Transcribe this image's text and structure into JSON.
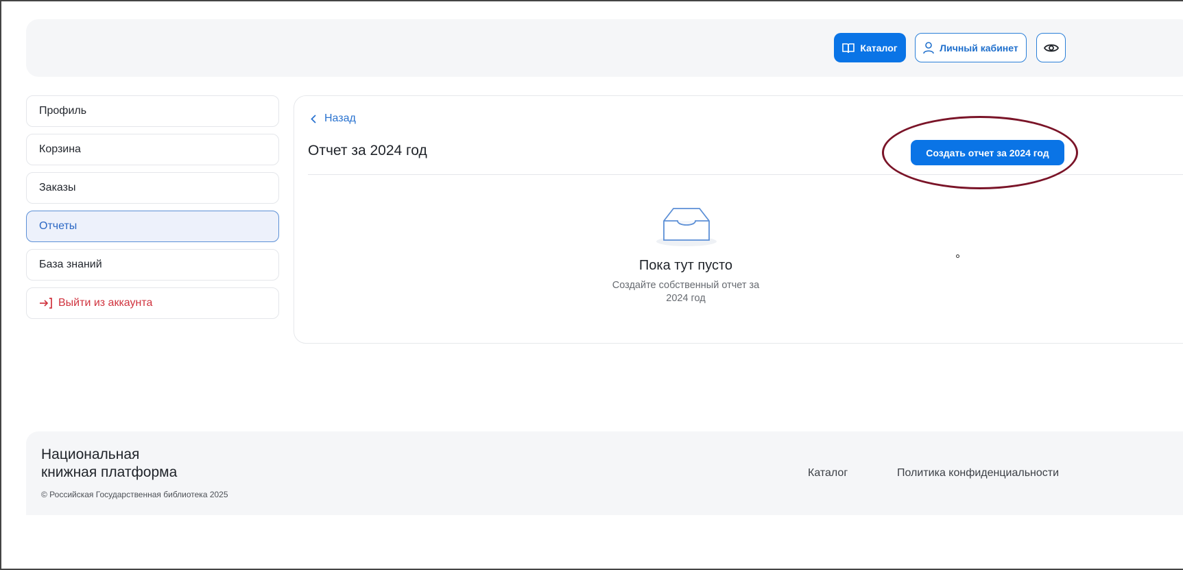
{
  "header": {
    "catalog_label": "Каталог",
    "cabinet_label": "Личный кабинет",
    "catalog_icon": "book-icon",
    "cabinet_icon": "user-icon",
    "accessibility_icon": "eye-icon"
  },
  "sidebar": {
    "items": [
      {
        "label": "Профиль"
      },
      {
        "label": "Корзина"
      },
      {
        "label": "Заказы"
      },
      {
        "label": "Отчеты",
        "active": true
      },
      {
        "label": "База знаний"
      }
    ],
    "logout_label": "Выйти из аккаунта",
    "logout_icon": "logout-arrow-icon"
  },
  "main": {
    "back_label": "Назад",
    "title": "Отчет за 2024 год",
    "create_button_label": "Создать отчет за 2024 год",
    "empty_state": {
      "icon": "inbox-tray-icon",
      "title": "Пока тут пусто",
      "subtitle_line1": "Создайте собственный отчет за",
      "subtitle_line2": "2024 год"
    }
  },
  "footer": {
    "brand_line1": "Национальная",
    "brand_line2": "книжная платформа",
    "copyright": "© Российская Государственная библиотека 2025",
    "link_catalog": "Каталог",
    "link_privacy": "Политика конфиденциальности"
  },
  "colors": {
    "primary": "#0a74e6",
    "link": "#2a73d0",
    "danger": "#d0333e",
    "annotation": "#7a1428",
    "active_bg": "#edf1fb"
  }
}
